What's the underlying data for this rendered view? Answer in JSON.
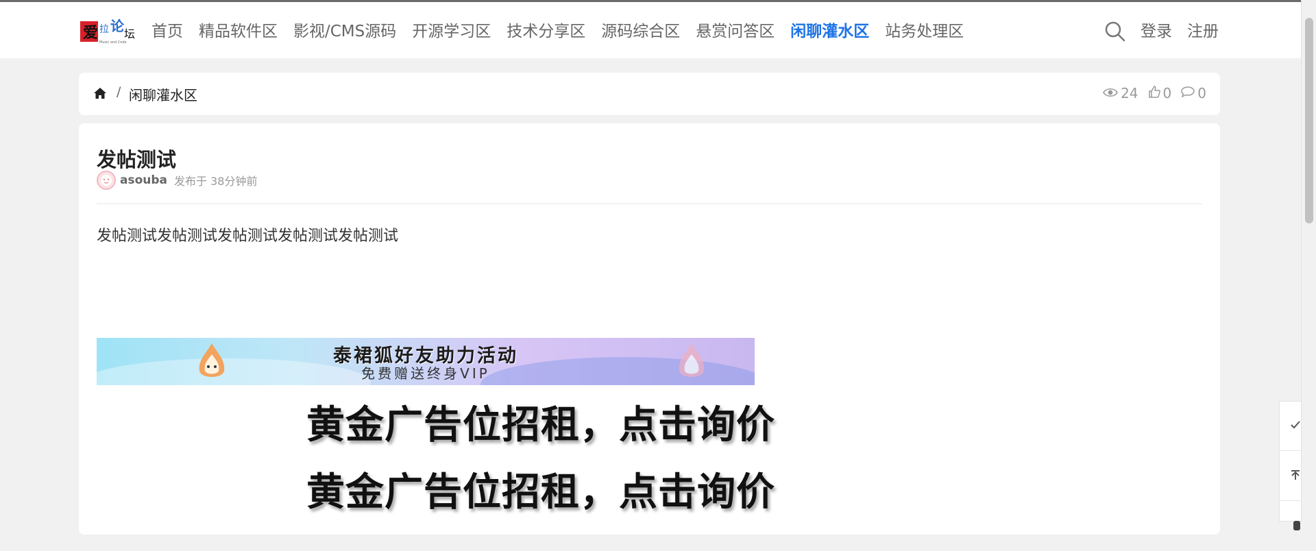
{
  "nav": {
    "logo_text": "爱拉论坛",
    "items": [
      {
        "label": "首页",
        "active": false
      },
      {
        "label": "精品软件区",
        "active": false
      },
      {
        "label": "影视/CMS源码",
        "active": false
      },
      {
        "label": "开源学习区",
        "active": false
      },
      {
        "label": "技术分享区",
        "active": false
      },
      {
        "label": "源码综合区",
        "active": false
      },
      {
        "label": "悬赏问答区",
        "active": false
      },
      {
        "label": "闲聊灌水区",
        "active": true
      },
      {
        "label": "站务处理区",
        "active": false
      }
    ],
    "search_icon": "search-icon",
    "login": "登录",
    "register": "注册",
    "accent_color": "#1e73e6"
  },
  "breadcrumb": {
    "home_icon": "home-icon",
    "separator": "/",
    "current": "闲聊灌水区"
  },
  "stats": {
    "views": "24",
    "likes": "0",
    "comments": "0"
  },
  "post": {
    "title": "发帖测试",
    "author": "asouba",
    "time": "发布于 38分钟前",
    "body": "发帖测试发帖测试发帖测试发帖测试发帖测试"
  },
  "ads": {
    "banner_title": "泰裙狐好友助力活动",
    "banner_sub": "免费赠送终身VIP",
    "text_ad_1": "黄金广告位招租，点击询价",
    "text_ad_2": "黄金广告位招租，点击询价"
  }
}
